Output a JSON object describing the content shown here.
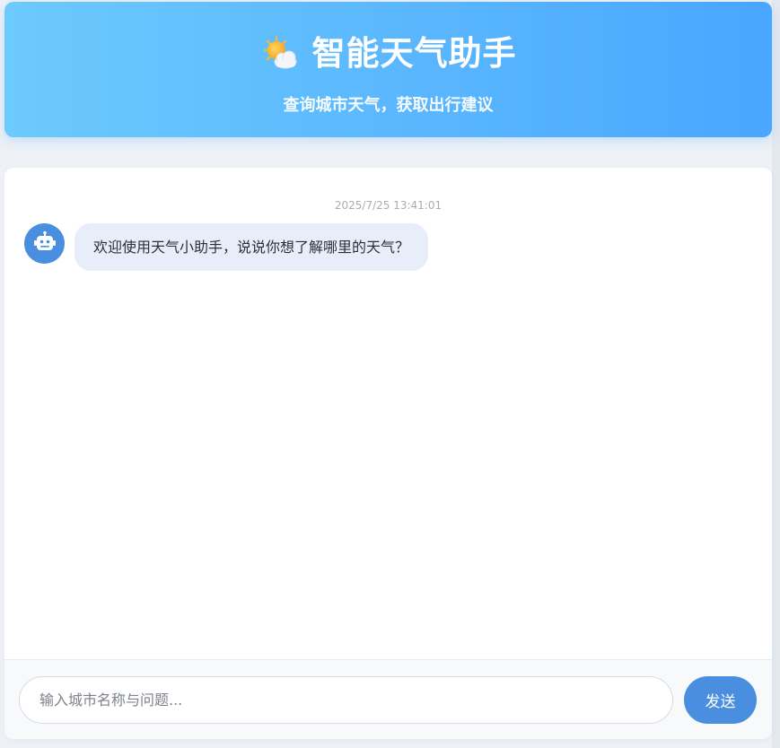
{
  "header": {
    "icon": "sun-behind-cloud-icon",
    "title": "智能天气助手",
    "subtitle": "查询城市天气，获取出行建议"
  },
  "chat": {
    "messages": [
      {
        "sender": "bot",
        "avatar_icon": "robot-icon",
        "timestamp": "2025/7/25 13:41:01",
        "text": "欢迎使用天气小助手，说说你想了解哪里的天气？"
      }
    ]
  },
  "input": {
    "placeholder": "输入城市名称与问题...",
    "value": "",
    "send_label": "发送"
  },
  "colors": {
    "header_gradient_start": "#6ccafd",
    "header_gradient_end": "#4aa6fe",
    "accent": "#4a8fdf",
    "bot_bubble": "#e8eef9"
  }
}
